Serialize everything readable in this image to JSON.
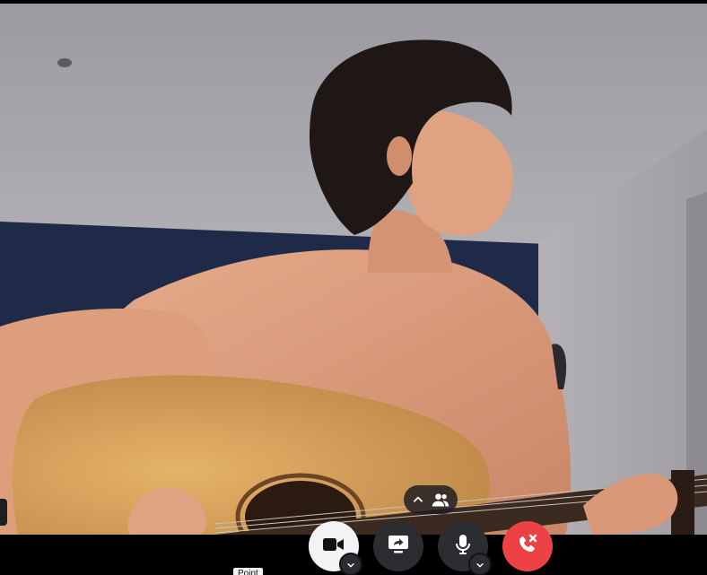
{
  "call": {
    "participants_icon": "people-icon",
    "expand_icon": "chevron-up-icon",
    "tooltip": "Point"
  },
  "controls": {
    "camera": {
      "icon": "video-camera-icon",
      "state": "on"
    },
    "camera_options_icon": "chevron-down-icon",
    "share_screen": {
      "icon": "screen-share-icon"
    },
    "microphone": {
      "icon": "microphone-icon",
      "state": "on"
    },
    "microphone_options_icon": "chevron-down-icon",
    "leave": {
      "icon": "phone-hangup-icon"
    }
  },
  "colors": {
    "leave_red": "#ed4245",
    "control_dark": "#2b2d31",
    "camera_active": "#f2f3f5"
  }
}
